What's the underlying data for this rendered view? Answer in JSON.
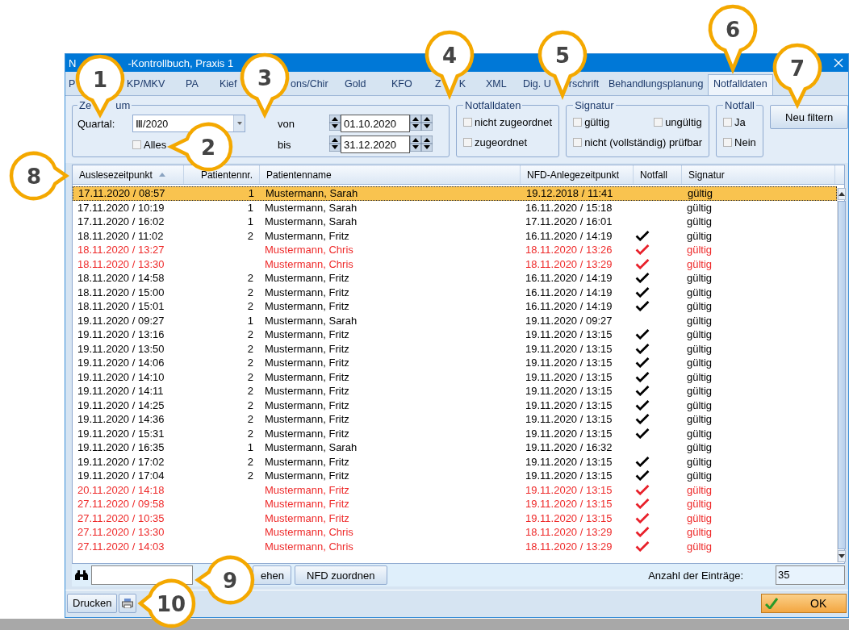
{
  "window": {
    "title_start": "N",
    "title": "-Kontrollbuch, Praxis 1"
  },
  "tabs": [
    {
      "label": "P",
      "selected": false
    },
    {
      "label": "KP/MKV",
      "selected": false
    },
    {
      "label": "PA",
      "selected": false
    },
    {
      "label": "Kief",
      "selected": false
    },
    {
      "label": "ons/Chir",
      "selected": false
    },
    {
      "label": "Gold",
      "selected": false
    },
    {
      "label": "KFO",
      "selected": false
    },
    {
      "label": "Z",
      "label_end": "K",
      "selected": false
    },
    {
      "label": "XML",
      "selected": false
    },
    {
      "label": "Dig. U",
      "label_end": "rschrift",
      "selected": false
    },
    {
      "label": "Behandlungsplanung",
      "selected": false
    },
    {
      "label": "Notfalldaten",
      "selected": true
    }
  ],
  "zeitraum": {
    "legend_start": "Ze",
    "legend_end": "um",
    "quartal_label": "Quartal:",
    "quartal_value": "Ⅲ/2020",
    "alles": {
      "label": "Alles",
      "checked": false
    },
    "von_label": "von",
    "von_value": "01.10.2020",
    "bis_label": "bis",
    "bis_value": "31.12.2020"
  },
  "groups": [
    {
      "legend": "Notfalldaten",
      "options": [
        {
          "label": "nicht zugeordnet",
          "checked": false
        },
        {
          "label": "zugeordnet",
          "checked": false
        }
      ]
    },
    {
      "legend": "Signatur",
      "options": [
        {
          "label": "gültig",
          "checked": false
        },
        {
          "label": "ungültig",
          "checked": false
        },
        {
          "label": "nicht (vollständig) prüfbar",
          "checked": false
        }
      ]
    },
    {
      "legend": "Notfall",
      "options": [
        {
          "label": "Ja",
          "checked": false
        },
        {
          "label": "Nein",
          "checked": false
        }
      ]
    }
  ],
  "filter_button": "Neu filtern",
  "table": {
    "columns": [
      "Auslesezeitpunkt",
      "Patientennr.",
      "Patientenname",
      "NFD-Anlegezeitpunkt",
      "Notfall",
      "Signatur"
    ],
    "rows": [
      {
        "time": "17.11.2020 / 08:57",
        "nr": "1",
        "name": "Mustermann, Sarah",
        "nfd": "19.12.2018 / 11:41",
        "notfall": false,
        "signatur": "gültig",
        "unassigned": false,
        "selected": true
      },
      {
        "time": "17.11.2020 / 10:19",
        "nr": "1",
        "name": "Mustermann, Sarah",
        "nfd": "16.11.2020 / 15:18",
        "notfall": false,
        "signatur": "gültig",
        "unassigned": false,
        "selected": false
      },
      {
        "time": "17.11.2020 / 16:02",
        "nr": "1",
        "name": "Mustermann, Sarah",
        "nfd": "17.11.2020 / 16:01",
        "notfall": false,
        "signatur": "gültig",
        "unassigned": false,
        "selected": false
      },
      {
        "time": "18.11.2020 / 11:02",
        "nr": "2",
        "name": "Mustermann, Fritz",
        "nfd": "16.11.2020 / 14:19",
        "notfall": true,
        "signatur": "gültig",
        "unassigned": false,
        "selected": false
      },
      {
        "time": "18.11.2020 / 13:27",
        "name": "Mustermann, Chris",
        "nfd": "18.11.2020 / 13:26",
        "notfall": true,
        "signatur": "gültig",
        "unassigned": true,
        "selected": false
      },
      {
        "time": "18.11.2020 / 13:30",
        "name": "Mustermann, Chris",
        "nfd": "18.11.2020 / 13:29",
        "notfall": true,
        "signatur": "gültig",
        "unassigned": true,
        "selected": false
      },
      {
        "time": "18.11.2020 / 14:58",
        "nr": "2",
        "name": "Mustermann, Fritz",
        "nfd": "16.11.2020 / 14:19",
        "notfall": true,
        "signatur": "gültig",
        "unassigned": false,
        "selected": false
      },
      {
        "time": "18.11.2020 / 15:00",
        "nr": "2",
        "name": "Mustermann, Fritz",
        "nfd": "16.11.2020 / 14:19",
        "notfall": true,
        "signatur": "gültig",
        "unassigned": false,
        "selected": false
      },
      {
        "time": "18.11.2020 / 15:01",
        "nr": "2",
        "name": "Mustermann, Fritz",
        "nfd": "16.11.2020 / 14:19",
        "notfall": true,
        "signatur": "gültig",
        "unassigned": false,
        "selected": false
      },
      {
        "time": "19.11.2020 / 09:27",
        "nr": "1",
        "name": "Mustermann, Sarah",
        "nfd": "19.11.2020 / 09:27",
        "notfall": false,
        "signatur": "gültig",
        "unassigned": false,
        "selected": false
      },
      {
        "time": "19.11.2020 / 13:16",
        "nr": "2",
        "name": "Mustermann, Fritz",
        "nfd": "19.11.2020 / 13:15",
        "notfall": true,
        "signatur": "gültig",
        "unassigned": false,
        "selected": false
      },
      {
        "time": "19.11.2020 / 13:50",
        "nr": "2",
        "name": "Mustermann, Fritz",
        "nfd": "19.11.2020 / 13:15",
        "notfall": true,
        "signatur": "gültig",
        "unassigned": false,
        "selected": false
      },
      {
        "time": "19.11.2020 / 14:06",
        "nr": "2",
        "name": "Mustermann, Fritz",
        "nfd": "19.11.2020 / 13:15",
        "notfall": true,
        "signatur": "gültig",
        "unassigned": false,
        "selected": false
      },
      {
        "time": "19.11.2020 / 14:10",
        "nr": "2",
        "name": "Mustermann, Fritz",
        "nfd": "19.11.2020 / 13:15",
        "notfall": true,
        "signatur": "gültig",
        "unassigned": false,
        "selected": false
      },
      {
        "time": "19.11.2020 / 14:11",
        "nr": "2",
        "name": "Mustermann, Fritz",
        "nfd": "19.11.2020 / 13:15",
        "notfall": true,
        "signatur": "gültig",
        "unassigned": false,
        "selected": false
      },
      {
        "time": "19.11.2020 / 14:25",
        "nr": "2",
        "name": "Mustermann, Fritz",
        "nfd": "19.11.2020 / 13:15",
        "notfall": true,
        "signatur": "gültig",
        "unassigned": false,
        "selected": false
      },
      {
        "time": "19.11.2020 / 14:36",
        "nr": "2",
        "name": "Mustermann, Fritz",
        "nfd": "19.11.2020 / 13:15",
        "notfall": true,
        "signatur": "gültig",
        "unassigned": false,
        "selected": false
      },
      {
        "time": "19.11.2020 / 15:31",
        "nr": "2",
        "name": "Mustermann, Fritz",
        "nfd": "19.11.2020 / 13:15",
        "notfall": true,
        "signatur": "gültig",
        "unassigned": false,
        "selected": false
      },
      {
        "time": "19.11.2020 / 16:35",
        "nr": "1",
        "name": "Mustermann, Sarah",
        "nfd": "19.11.2020 / 16:32",
        "notfall": false,
        "signatur": "gültig",
        "unassigned": false,
        "selected": false
      },
      {
        "time": "19.11.2020 / 17:02",
        "nr": "2",
        "name": "Mustermann, Fritz",
        "nfd": "19.11.2020 / 13:15",
        "notfall": true,
        "signatur": "gültig",
        "unassigned": false,
        "selected": false
      },
      {
        "time": "19.11.2020 / 17:04",
        "nr": "2",
        "name": "Mustermann, Fritz",
        "nfd": "19.11.2020 / 13:15",
        "notfall": true,
        "signatur": "gültig",
        "unassigned": false,
        "selected": false
      },
      {
        "time": "20.11.2020 / 14:18",
        "name": "Mustermann, Fritz",
        "nfd": "19.11.2020 / 13:15",
        "notfall": true,
        "signatur": "gültig",
        "unassigned": true,
        "selected": false
      },
      {
        "time": "27.11.2020 / 09:58",
        "name": "Mustermann, Fritz",
        "nfd": "19.11.2020 / 13:15",
        "notfall": true,
        "signatur": "gültig",
        "unassigned": true,
        "selected": false
      },
      {
        "time": "27.11.2020 / 10:35",
        "name": "Mustermann, Fritz",
        "nfd": "19.11.2020 / 13:15",
        "notfall": true,
        "signatur": "gültig",
        "unassigned": true,
        "selected": false
      },
      {
        "time": "27.11.2020 / 13:30",
        "name": "Mustermann, Chris",
        "nfd": "18.11.2020 / 13:29",
        "notfall": true,
        "signatur": "gültig",
        "unassigned": true,
        "selected": false
      },
      {
        "time": "27.11.2020 / 14:03",
        "name": "Mustermann, Chris",
        "nfd": "18.11.2020 / 13:29",
        "notfall": true,
        "signatur": "gültig",
        "unassigned": true,
        "selected": false
      }
    ]
  },
  "search_bar": {
    "buttons": [
      "ehen",
      "NFD zuordnen"
    ],
    "count_label": "Anzahl der Einträge:",
    "count_value": "35"
  },
  "footer": {
    "print_button": "Drucken",
    "ok_button": "OK"
  },
  "callouts": [
    "1",
    "2",
    "3",
    "4",
    "5",
    "6",
    "7",
    "8",
    "9",
    "10"
  ]
}
